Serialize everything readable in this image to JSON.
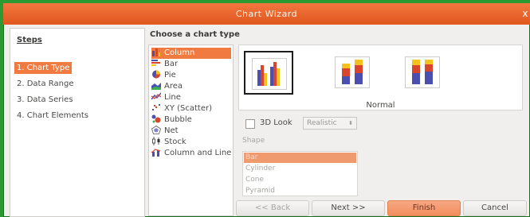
{
  "window": {
    "title": "Chart Wizard",
    "close_glyph": "ⅹ"
  },
  "steps": {
    "heading": "Steps",
    "items": [
      {
        "label": "1. Chart Type",
        "active": true
      },
      {
        "label": "2. Data Range",
        "active": false
      },
      {
        "label": "3. Data Series",
        "active": false
      },
      {
        "label": "4. Chart Elements",
        "active": false
      }
    ]
  },
  "chart_type": {
    "heading": "Choose a chart type",
    "items": [
      {
        "label": "Column",
        "icon": "column-chart-icon",
        "selected": true
      },
      {
        "label": "Bar",
        "icon": "bar-chart-icon",
        "selected": false
      },
      {
        "label": "Pie",
        "icon": "pie-chart-icon",
        "selected": false
      },
      {
        "label": "Area",
        "icon": "area-chart-icon",
        "selected": false
      },
      {
        "label": "Line",
        "icon": "line-chart-icon",
        "selected": false
      },
      {
        "label": "XY (Scatter)",
        "icon": "scatter-chart-icon",
        "selected": false
      },
      {
        "label": "Bubble",
        "icon": "bubble-chart-icon",
        "selected": false
      },
      {
        "label": "Net",
        "icon": "net-chart-icon",
        "selected": false
      },
      {
        "label": "Stock",
        "icon": "stock-chart-icon",
        "selected": false
      },
      {
        "label": "Column and Line",
        "icon": "column-line-chart-icon",
        "selected": false
      }
    ]
  },
  "variants": {
    "selected_label": "Normal",
    "items": [
      {
        "name": "normal",
        "selected": true
      },
      {
        "name": "stacked",
        "selected": false
      },
      {
        "name": "percent-stacked",
        "selected": false
      }
    ]
  },
  "options": {
    "three_d_label": "3D Look",
    "three_d_checked": false,
    "three_d_style": "Realistic",
    "shape_label": "Shape",
    "shapes": [
      {
        "label": "Bar",
        "selected": true
      },
      {
        "label": "Cylinder",
        "selected": false
      },
      {
        "label": "Cone",
        "selected": false
      },
      {
        "label": "Pyramid",
        "selected": false
      }
    ]
  },
  "buttons": {
    "back": "<< Back",
    "next": "Next >>",
    "finish": "Finish",
    "cancel": "Cancel"
  },
  "colors": {
    "accent": "#f07a3f",
    "title_bar": "#e8642a",
    "desktop": "#2b9a33",
    "bar_blue": "#4a4fb0",
    "bar_red": "#d8452a",
    "bar_yellow": "#f3c21f"
  }
}
